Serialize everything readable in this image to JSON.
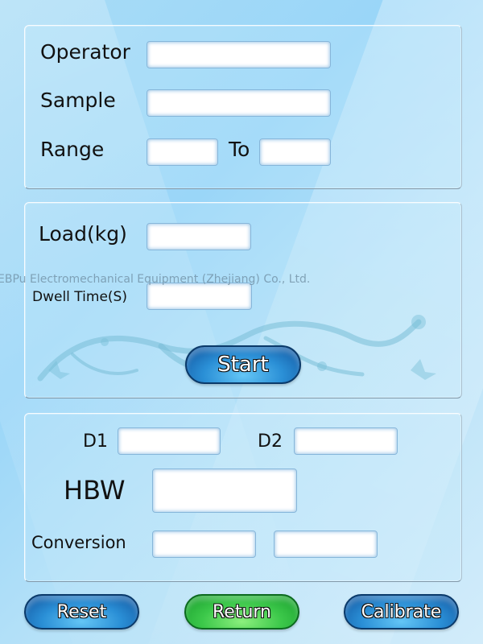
{
  "watermark": "EBPu Electromechanical Equipment (Zhejiang) Co., Ltd.",
  "sample_info": {
    "operator_label": "Operator",
    "operator_value": "",
    "sample_label": "Sample",
    "sample_value": "",
    "range_label": "Range",
    "range_from_value": "",
    "range_to_label": "To",
    "range_to_value": ""
  },
  "test_params": {
    "load_label": "Load(kg)",
    "load_value": "",
    "dwell_label": "Dwell Time(S)",
    "dwell_value": "",
    "start_label": "Start"
  },
  "results": {
    "d1_label": "D1",
    "d1_value": "",
    "d2_label": "D2",
    "d2_value": "",
    "hbw_label": "HBW",
    "hbw_value": "",
    "conversion_label": "Conversion",
    "conversion_value_1": "",
    "conversion_value_2": ""
  },
  "footer": {
    "reset_label": "Reset",
    "return_label": "Return",
    "calibrate_label": "Calibrate",
    "return_color": "#3cc84a",
    "button_color": "#2a8fd6"
  }
}
